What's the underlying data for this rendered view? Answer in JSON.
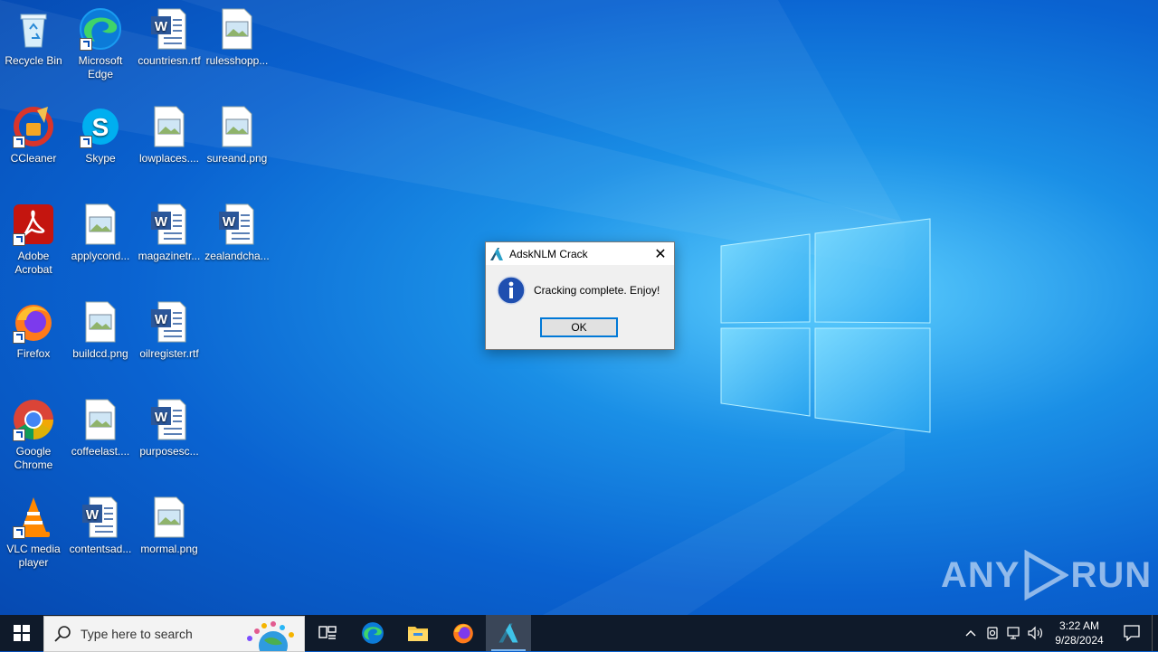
{
  "desktop": {
    "icons": [
      {
        "label": "Recycle Bin",
        "icon": "recycle-bin-icon"
      },
      {
        "label": "Microsoft Edge",
        "icon": "edge-icon"
      },
      {
        "label": "countriesn.rtf",
        "icon": "word-doc-icon"
      },
      {
        "label": "rulesshopp...",
        "icon": "image-file-icon"
      },
      {
        "label": "CCleaner",
        "icon": "ccleaner-icon"
      },
      {
        "label": "Skype",
        "icon": "skype-icon"
      },
      {
        "label": "lowplaces....",
        "icon": "image-file-icon"
      },
      {
        "label": "sureand.png",
        "icon": "image-file-icon"
      },
      {
        "label": "Adobe Acrobat",
        "icon": "acrobat-icon"
      },
      {
        "label": "applycond...",
        "icon": "image-file-icon"
      },
      {
        "label": "magazinetr...",
        "icon": "word-doc-icon"
      },
      {
        "label": "zealandcha...",
        "icon": "word-doc-icon"
      },
      {
        "label": "Firefox",
        "icon": "firefox-icon"
      },
      {
        "label": "buildcd.png",
        "icon": "image-file-icon"
      },
      {
        "label": "oilregister.rtf",
        "icon": "word-doc-icon"
      },
      {
        "label": "Google Chrome",
        "icon": "chrome-icon"
      },
      {
        "label": "coffeelast....",
        "icon": "image-file-icon"
      },
      {
        "label": "purposesc...",
        "icon": "word-doc-icon"
      },
      {
        "label": "VLC media player",
        "icon": "vlc-icon"
      },
      {
        "label": "contentsad...",
        "icon": "word-doc-icon"
      },
      {
        "label": "mormal.png",
        "icon": "image-file-icon"
      }
    ]
  },
  "dialog": {
    "title": "AdskNLM Crack",
    "message": "Cracking complete. Enjoy!",
    "ok_label": "OK",
    "close_glyph": "✕"
  },
  "watermark": {
    "left": "ANY",
    "right": "RUN"
  },
  "taskbar": {
    "search_placeholder": "Type here to search",
    "pinned": [
      "task-view-icon",
      "edge-icon",
      "file-explorer-icon",
      "firefox-icon",
      "autodesk-icon"
    ]
  },
  "tray": {
    "time": "3:22 AM",
    "date": "9/28/2024"
  },
  "colors": {
    "taskbar": "#0f1a2a",
    "accent": "#0078d7",
    "desktop_blue": "#0a63d1"
  }
}
